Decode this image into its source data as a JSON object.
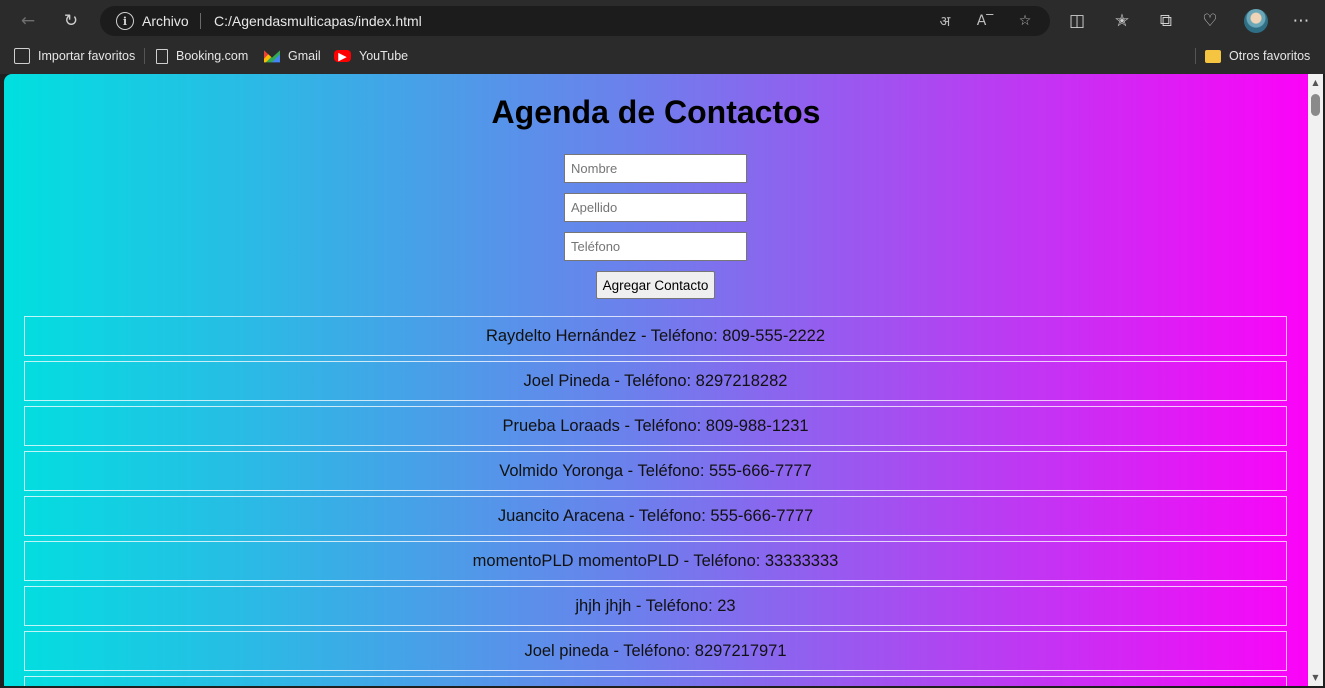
{
  "browser": {
    "address_scheme": "Archivo",
    "address_url": "C:/Agendasmulticapas/index.html",
    "bookmarks": [
      {
        "label": "Importar favoritos",
        "icon": "import-icon"
      },
      {
        "label": "Booking.com",
        "icon": "page-icon"
      },
      {
        "label": "Gmail",
        "icon": "gmail-icon"
      },
      {
        "label": "YouTube",
        "icon": "youtube-icon"
      }
    ],
    "other_favorites": "Otros favoritos"
  },
  "page": {
    "title": "Agenda de Contactos",
    "form": {
      "nombre_placeholder": "Nombre",
      "apellido_placeholder": "Apellido",
      "telefono_placeholder": "Teléfono",
      "submit_label": "Agregar Contacto"
    },
    "contacts": [
      "Raydelto Hernández - Teléfono: 809-555-2222",
      "Joel Pineda - Teléfono: 8297218282",
      "Prueba Loraads - Teléfono: 809-988-1231",
      "Volmido Yoronga - Teléfono: 555-666-7777",
      "Juancito Aracena - Teléfono: 555-666-7777",
      "momentoPLD momentoPLD - Teléfono: 33333333",
      "jhjh jhjh - Teléfono: 23",
      "Joel pineda - Teléfono: 8297217971"
    ]
  },
  "colors": {
    "gradient_start": "#00e0e0",
    "gradient_mid": "#6d7fec",
    "gradient_end": "#ff00f8"
  }
}
